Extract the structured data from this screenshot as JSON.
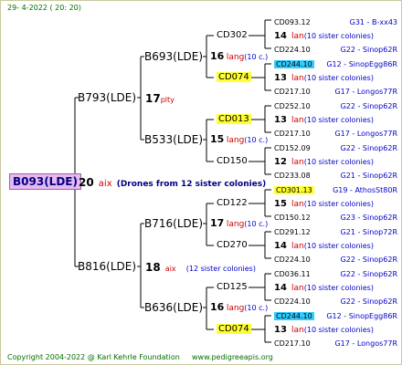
{
  "header": {
    "date": "29-  4-2022 ( 20: 20)"
  },
  "footer": {
    "copyright": "Copyright 2004-2022 @ Karl Kehrle Foundation",
    "site": "www.pedigreeapis.org"
  },
  "root": {
    "id": "B093(LDE)",
    "num": "20",
    "race": "aix",
    "note": "(Drones from 12 sister colonies)"
  },
  "dams": [
    {
      "id": "B793(LDE)",
      "num": "17",
      "race": "plty"
    },
    {
      "id": "B816(LDE)",
      "num": "18",
      "race": "aix",
      "note": "(12 sister colonies)"
    }
  ],
  "granddams": [
    {
      "id": "B693(LDE)",
      "num": "16",
      "race": "lang",
      "count": "(10 c.)"
    },
    {
      "id": "B533(LDE)",
      "num": "15",
      "race": "lang",
      "count": "(10 c.)"
    },
    {
      "id": "B716(LDE)",
      "num": "17",
      "race": "lang",
      "count": "(10 c.)"
    },
    {
      "id": "B636(LDE)",
      "num": "16",
      "race": "lang",
      "count": "(10 c.)"
    }
  ],
  "ggd": [
    {
      "id": "CD302"
    },
    {
      "id": "CD074"
    },
    {
      "id": "CD013"
    },
    {
      "id": "CD150"
    },
    {
      "id": "CD122"
    },
    {
      "id": "CD270"
    },
    {
      "id": "CD125"
    },
    {
      "id": "CD074"
    }
  ],
  "drones": [
    {
      "top": "CD093.12",
      "loc": "G31 - B-xx43",
      "n": "14",
      "lang": "lan",
      "sc": "(10 sister colonies)",
      "bot": "CD224.10",
      "bloc": "G22 - Sinop62R"
    },
    {
      "top": "CD244.10",
      "loc": "G12 - SinopEgg86R",
      "n": "13",
      "lang": "lan",
      "sc": "(10 sister colonies)",
      "bot": "CD217.10",
      "bloc": "G17 - Longos77R"
    },
    {
      "top": "CD252.10",
      "loc": "G22 - Sinop62R",
      "n": "13",
      "lang": "lan",
      "sc": "(10 sister colonies)",
      "bot": "CD217.10",
      "bloc": "G17 - Longos77R"
    },
    {
      "top": "CD152.09",
      "loc": "G22 - Sinop62R",
      "n": "12",
      "lang": "lan",
      "sc": "(10 sister colonies)",
      "bot": "CD233.08",
      "bloc": "G21 - Sinop62R"
    },
    {
      "top": "CD301.13",
      "loc": "G19 - AthosSt80R",
      "n": "15",
      "lang": "lan",
      "sc": "(10 sister colonies)",
      "bot": "CD150.12",
      "bloc": "G23 - Sinop62R"
    },
    {
      "top": "CD291.12",
      "loc": "G21 - Sinop72R",
      "n": "14",
      "lang": "lan",
      "sc": "(10 sister colonies)",
      "bot": "CD224.10",
      "bloc": "G22 - Sinop62R"
    },
    {
      "top": "CD036.11",
      "loc": "G22 - Sinop62R",
      "n": "14",
      "lang": "lan",
      "sc": "(10 sister colonies)",
      "bot": "CD224.10",
      "bloc": "G22 - Sinop62R"
    },
    {
      "top": "CD244.10",
      "loc": "G12 - SinopEgg86R",
      "n": "13",
      "lang": "lan",
      "sc": "(10 sister colonies)",
      "bot": "CD217.10",
      "bloc": "G17 - Longos77R"
    }
  ]
}
